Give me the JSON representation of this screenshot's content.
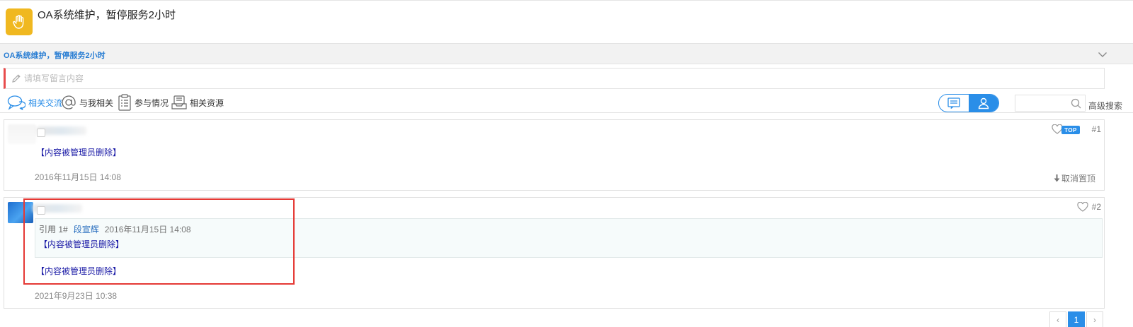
{
  "header": {
    "title": "OA系统维护，暂停服务2小时",
    "icon": "hand-stop-icon",
    "icon_color": "#f0b820"
  },
  "section": {
    "title": "OA系统维护，暂停服务2小时"
  },
  "message_input": {
    "placeholder": "请填写留言内容"
  },
  "tabs": [
    {
      "label": "相关交流",
      "icon": "chat-bubbles-icon",
      "active": true
    },
    {
      "label": "与我相关",
      "icon": "at-sign-icon",
      "active": false
    },
    {
      "label": "参与情况",
      "icon": "clipboard-icon",
      "active": false
    },
    {
      "label": "相关资源",
      "icon": "tray-icon",
      "active": false
    }
  ],
  "view_toggle": {
    "options": [
      "list-view-icon",
      "user-view-icon"
    ],
    "selected": "user-view-icon"
  },
  "search": {
    "value": "",
    "advanced_label": "高级搜索"
  },
  "posts": [
    {
      "floor": "#1",
      "content": "【内容被管理员删除】",
      "time": "2016年11月15日 14:08",
      "top_badge": "TOP",
      "untop_label": "取消置顶"
    },
    {
      "floor": "#2",
      "quote": {
        "ref": "引用 1#",
        "author": "段宣辉",
        "time": "2016年11月15日 14:08",
        "content": "【内容被管理员删除】"
      },
      "content": "【内容被管理员删除】",
      "time": "2021年9月23日 10:38"
    }
  ],
  "pagination": {
    "prev": "‹",
    "current": "1",
    "next": "›"
  },
  "colors": {
    "accent": "#2a8ee8",
    "highlight": "#e53935",
    "deleted_text": "#1a1aa6"
  }
}
